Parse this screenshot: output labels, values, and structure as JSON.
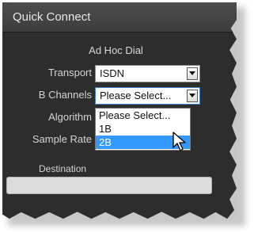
{
  "dialog": {
    "title": "Quick Connect",
    "section_title": "Ad Hoc Dial"
  },
  "fields": {
    "transport": {
      "label": "Transport",
      "value": "ISDN"
    },
    "b_channels": {
      "label": "B Channels",
      "value": "Please Select...",
      "options": [
        "Please Select...",
        "1B",
        "2B"
      ],
      "highlighted_option": "2B"
    },
    "algorithm": {
      "label": "Algorithm"
    },
    "sample_rate": {
      "label": "Sample Rate"
    },
    "destination": {
      "label": "Destination",
      "value": ""
    }
  },
  "icons": {
    "dropdown_arrow": "chevron-down-icon",
    "cursor": "mouse-pointer-icon"
  },
  "colors": {
    "panel_background": "#2d2d2d",
    "titlebar": "#444444",
    "selection": "#3399ff",
    "focus_border": "#3b83d9"
  }
}
